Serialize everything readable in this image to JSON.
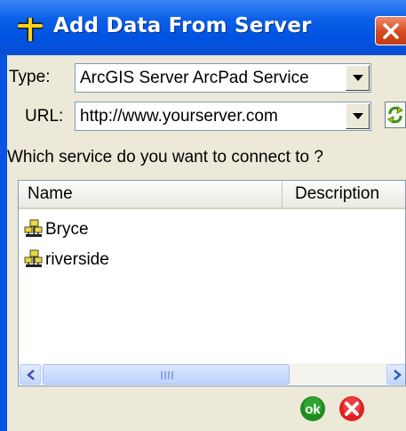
{
  "window": {
    "title": "Add Data From Server",
    "icons": {
      "app": "add-data-plus-icon",
      "close": "close-icon"
    }
  },
  "form": {
    "type_label": "Type:",
    "type_value": "ArcGIS Server ArcPad Service",
    "url_label": "URL:",
    "url_value": "http://www.yourserver.com",
    "refresh_icon": "refresh-icon",
    "question": "Which service do you want to connect to ?"
  },
  "services": {
    "columns": [
      "Name",
      "Description"
    ],
    "rows": [
      {
        "name": "Bryce",
        "icon": "service-icon"
      },
      {
        "name": "riverside",
        "icon": "service-icon"
      }
    ]
  },
  "buttons": {
    "ok_label": "ok",
    "cancel_icon": "cancel-icon"
  },
  "colors": {
    "titlebar": "#0a54e4",
    "client_bg": "#ece9d8",
    "ok_green": "#1e8c1e",
    "cancel_red": "#e02020"
  }
}
